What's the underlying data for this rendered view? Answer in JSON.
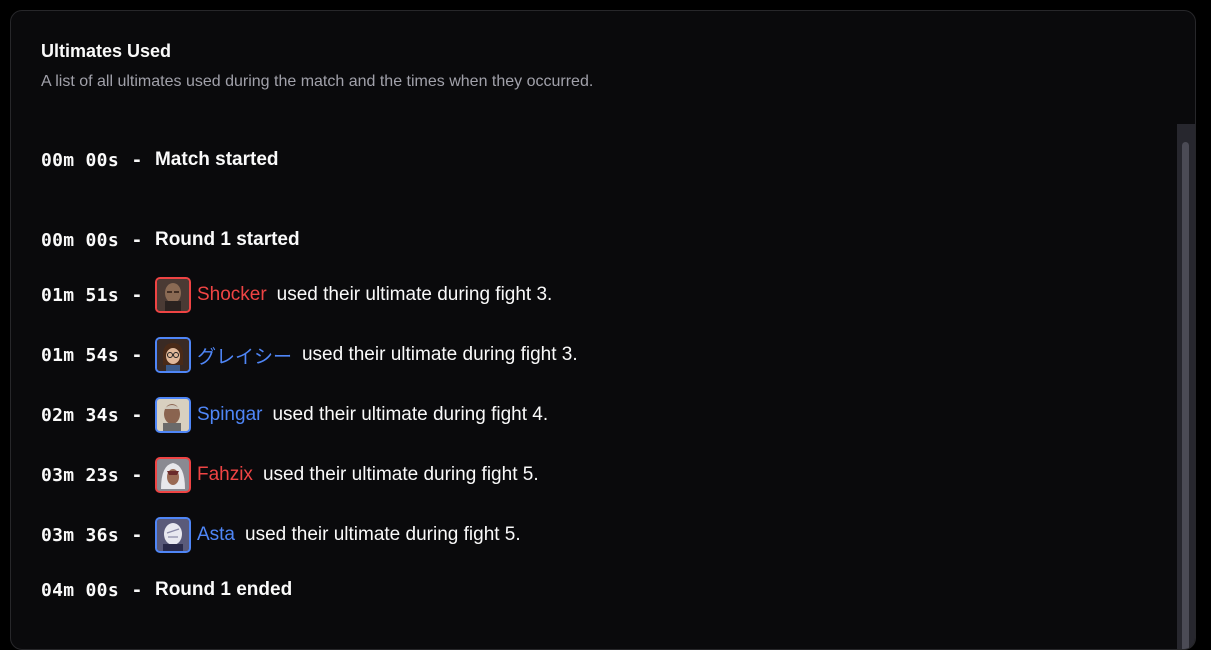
{
  "panel": {
    "title": "Ultimates Used",
    "subtitle": "A list of all ultimates used during the match and the times when they occurred."
  },
  "colors": {
    "red_team": "#ef4444",
    "blue_team": "#4f86f7"
  },
  "events": [
    {
      "time": "00m 00s",
      "sep": "-",
      "text": "Match started"
    },
    {
      "time": "00m 00s",
      "sep": "-",
      "text": "Round 1 started"
    },
    {
      "time": "01m 51s",
      "sep": "-",
      "player": "Shocker",
      "team": "red",
      "avatar_icon": "hero-portrait-bald-man-icon",
      "message": "used their ultimate during fight 3."
    },
    {
      "time": "01m 54s",
      "sep": "-",
      "player": "グレイシー",
      "team": "blue",
      "avatar_icon": "hero-portrait-woman-glasses-icon",
      "message": "used their ultimate during fight 3."
    },
    {
      "time": "02m 34s",
      "sep": "-",
      "player": "Spingar",
      "team": "blue",
      "avatar_icon": "hero-portrait-bald-man-icon",
      "message": "used their ultimate during fight 4."
    },
    {
      "time": "03m 23s",
      "sep": "-",
      "player": "Fahzix",
      "team": "red",
      "avatar_icon": "hero-portrait-hooded-woman-icon",
      "message": "used their ultimate during fight 5."
    },
    {
      "time": "03m 36s",
      "sep": "-",
      "player": "Asta",
      "team": "blue",
      "avatar_icon": "hero-portrait-masked-icon",
      "message": "used their ultimate during fight 5."
    },
    {
      "time": "04m 00s",
      "sep": "-",
      "text": "Round 1 ended"
    }
  ]
}
